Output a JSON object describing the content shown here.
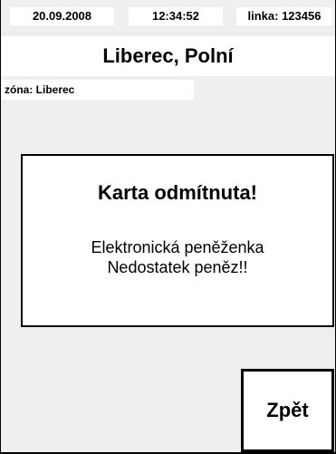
{
  "header": {
    "date": "20.09.2008",
    "time": "12:34:52",
    "line": "linka: 123456"
  },
  "location": {
    "name": "Liberec, Polní",
    "zone": "zóna: Liberec"
  },
  "message": {
    "title": "Karta odmítnuta!",
    "line1": "Elektronická peněženka",
    "line2": "Nedostatek peněz!!"
  },
  "actions": {
    "back_label": "Zpět"
  }
}
